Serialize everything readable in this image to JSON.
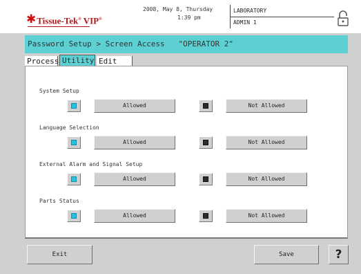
{
  "header": {
    "logo": {
      "brand": "Tissue-Tek",
      "model": "VIP",
      "brand_color": "#b01818"
    },
    "datetime": {
      "date": "2008, May 8, Thursday",
      "time": "1:39 pm"
    },
    "department": "LABORATORY",
    "user": "ADMIN 1",
    "lock_icon": "padlock-icon"
  },
  "title_bar": {
    "breadcrumb": "Password Setup > Screen Access   \"OPERATOR 2\"",
    "accent_color": "#5dd0d3"
  },
  "tabs": [
    {
      "label": "Process",
      "active": false
    },
    {
      "label": "Utility",
      "active": true
    },
    {
      "label": "Edit",
      "active": false
    }
  ],
  "settings": [
    {
      "label": "System Setup",
      "allowed_label": "Allowed",
      "not_allowed_label": "Not Allowed",
      "selected": "allowed"
    },
    {
      "label": "Language Selection",
      "allowed_label": "Allowed",
      "not_allowed_label": "Not Allowed",
      "selected": "allowed"
    },
    {
      "label": "External Alarm and Signal Setup",
      "allowed_label": "Allowed",
      "not_allowed_label": "Not Allowed",
      "selected": "allowed"
    },
    {
      "label": "Parts Status",
      "allowed_label": "Allowed",
      "not_allowed_label": "Not Allowed",
      "selected": "allowed"
    }
  ],
  "footer": {
    "exit_label": "Exit",
    "save_label": "Save",
    "help_label": "?"
  },
  "colors": {
    "indicator_on": "#24c4e0",
    "indicator_off": "#2c2c2c"
  }
}
